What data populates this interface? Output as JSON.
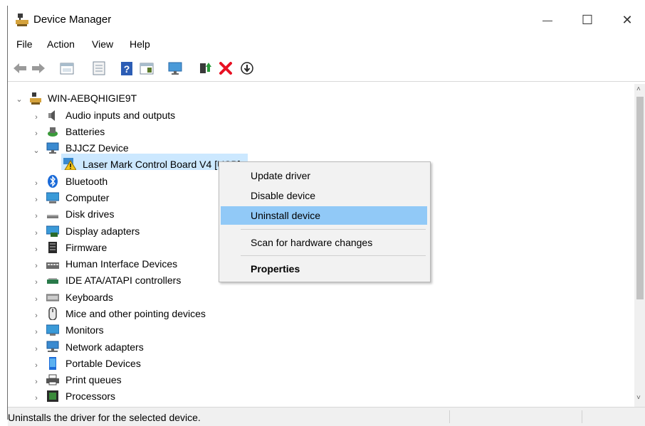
{
  "window": {
    "title": "Device Manager",
    "minimize_label": "—",
    "maximize_label": "☐",
    "close_label": "✕"
  },
  "menubar": {
    "items": [
      {
        "label": "File"
      },
      {
        "label": "Action"
      },
      {
        "label": "View"
      },
      {
        "label": "Help"
      }
    ]
  },
  "toolbar": {
    "icons": [
      "back-icon",
      "forward-icon",
      "properties-view-icon",
      "show-hidden-icon",
      "help-icon",
      "console-tree-icon",
      "monitor-icon",
      "update-driver-icon",
      "uninstall-icon",
      "scan-hardware-icon"
    ]
  },
  "tree": {
    "root": "WIN-AEBQHIGIE9T",
    "categories": [
      {
        "label": "Audio inputs and outputs",
        "icon": "speaker-icon"
      },
      {
        "label": "Batteries",
        "icon": "battery-icon"
      },
      {
        "label": "BJJCZ Device",
        "icon": "network-device-icon",
        "expanded": true,
        "children": [
          {
            "label": "Laser Mark Control Board V4 [USB]",
            "icon": "warning-icon"
          }
        ]
      },
      {
        "label": "Bluetooth",
        "icon": "bluetooth-icon"
      },
      {
        "label": "Computer",
        "icon": "computer-icon"
      },
      {
        "label": "Disk drives",
        "icon": "disk-icon"
      },
      {
        "label": "Display adapters",
        "icon": "display-adapter-icon"
      },
      {
        "label": "Firmware",
        "icon": "firmware-icon"
      },
      {
        "label": "Human Interface Devices",
        "icon": "hid-icon"
      },
      {
        "label": "IDE ATA/ATAPI controllers",
        "icon": "ide-icon"
      },
      {
        "label": "Keyboards",
        "icon": "keyboard-icon"
      },
      {
        "label": "Mice and other pointing devices",
        "icon": "mouse-icon"
      },
      {
        "label": "Monitors",
        "icon": "monitor-icon"
      },
      {
        "label": "Network adapters",
        "icon": "network-adapter-icon"
      },
      {
        "label": "Portable Devices",
        "icon": "portable-device-icon"
      },
      {
        "label": "Print queues",
        "icon": "printer-icon"
      },
      {
        "label": "Processors",
        "icon": "processor-icon"
      }
    ]
  },
  "context_menu": {
    "items": [
      {
        "label": "Update driver"
      },
      {
        "label": "Disable device"
      },
      {
        "label": "Uninstall device",
        "highlighted": true
      },
      {
        "label": "Scan for hardware changes"
      },
      {
        "label": "Properties",
        "bold": true
      }
    ]
  },
  "status_bar": {
    "text": "Uninstalls the driver for the selected device."
  },
  "colors": {
    "selection": "#cce8ff",
    "menu_highlight": "#91c9f7",
    "uninstall_red": "#e81123"
  }
}
